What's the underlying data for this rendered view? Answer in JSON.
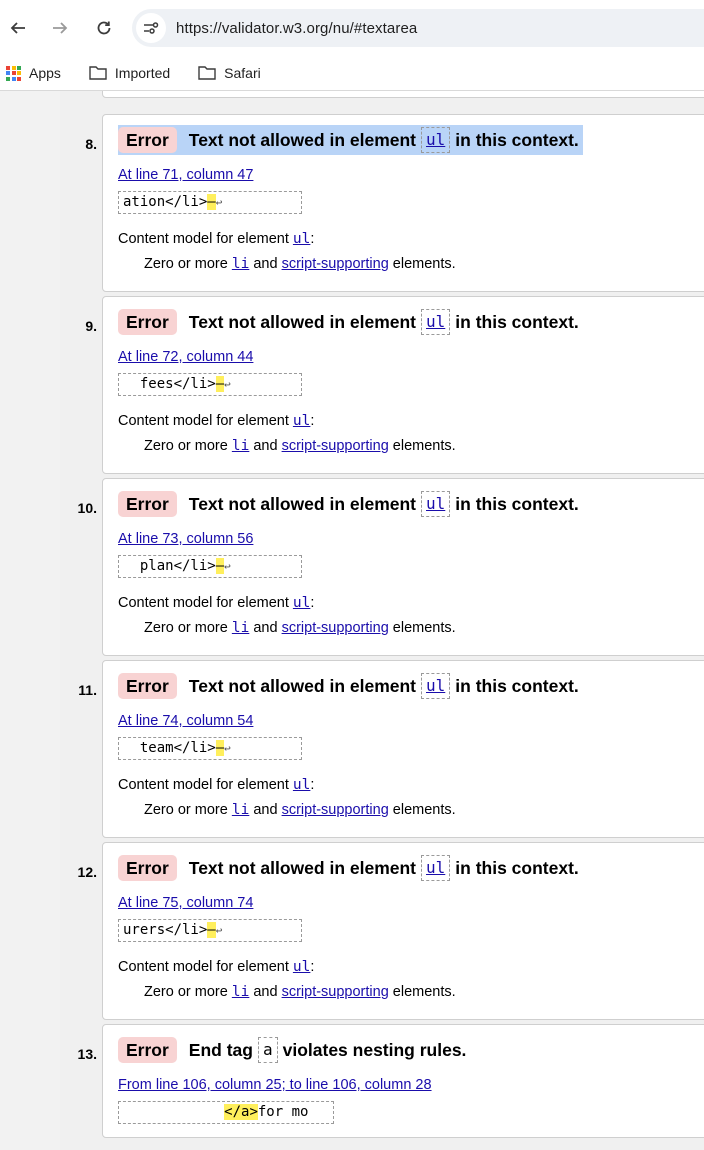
{
  "browser": {
    "url": "https://validator.w3.org/nu/#textarea",
    "bookmarks": [
      "Apps",
      "Imported",
      "Safari"
    ]
  },
  "messages": [
    {
      "num": "8.",
      "badge": "Error",
      "pre": "Text not allowed in element",
      "code": "ul",
      "post": "in this context.",
      "location": "At line 71, column 47",
      "extract_before": "ation</li>",
      "extract_mark": "–",
      "extract_after": "↩",
      "model_label": "Content model for element",
      "model_code": "ul",
      "model_colon": ":",
      "model_pre": "Zero or more",
      "model_li": "li",
      "model_and": "and",
      "model_link": "script-supporting",
      "model_post": "elements."
    },
    {
      "num": "9.",
      "badge": "Error",
      "pre": "Text not allowed in element",
      "code": "ul",
      "post": "in this context.",
      "location": "At line 72, column 44",
      "extract_before": "  fees</li>",
      "extract_mark": "–",
      "extract_after": "↩",
      "model_label": "Content model for element",
      "model_code": "ul",
      "model_colon": ":",
      "model_pre": "Zero or more",
      "model_li": "li",
      "model_and": "and",
      "model_link": "script-supporting",
      "model_post": "elements."
    },
    {
      "num": "10.",
      "badge": "Error",
      "pre": "Text not allowed in element",
      "code": "ul",
      "post": "in this context.",
      "location": "At line 73, column 56",
      "extract_before": "  plan</li>",
      "extract_mark": "–",
      "extract_after": "↩",
      "model_label": "Content model for element",
      "model_code": "ul",
      "model_colon": ":",
      "model_pre": "Zero or more",
      "model_li": "li",
      "model_and": "and",
      "model_link": "script-supporting",
      "model_post": "elements."
    },
    {
      "num": "11.",
      "badge": "Error",
      "pre": "Text not allowed in element",
      "code": "ul",
      "post": "in this context.",
      "location": "At line 74, column 54",
      "extract_before": "  team</li>",
      "extract_mark": "–",
      "extract_after": "↩",
      "model_label": "Content model for element",
      "model_code": "ul",
      "model_colon": ":",
      "model_pre": "Zero or more",
      "model_li": "li",
      "model_and": "and",
      "model_link": "script-supporting",
      "model_post": "elements."
    },
    {
      "num": "12.",
      "badge": "Error",
      "pre": "Text not allowed in element",
      "code": "ul",
      "post": "in this context.",
      "location": "At line 75, column 74",
      "extract_before": "urers</li>",
      "extract_mark": "–",
      "extract_after": "↩",
      "model_label": "Content model for element",
      "model_code": "ul",
      "model_colon": ":",
      "model_pre": "Zero or more",
      "model_li": "li",
      "model_and": "and",
      "model_link": "script-supporting",
      "model_post": "elements."
    }
  ],
  "last_message": {
    "num": "13.",
    "badge": "Error",
    "pre": "End tag",
    "code": "a",
    "post": "violates nesting rules.",
    "location": "From line 106, column 25; to line 106, column 28",
    "extract_before": "            ",
    "extract_mark": "</a>",
    "extract_after": "for mo"
  }
}
